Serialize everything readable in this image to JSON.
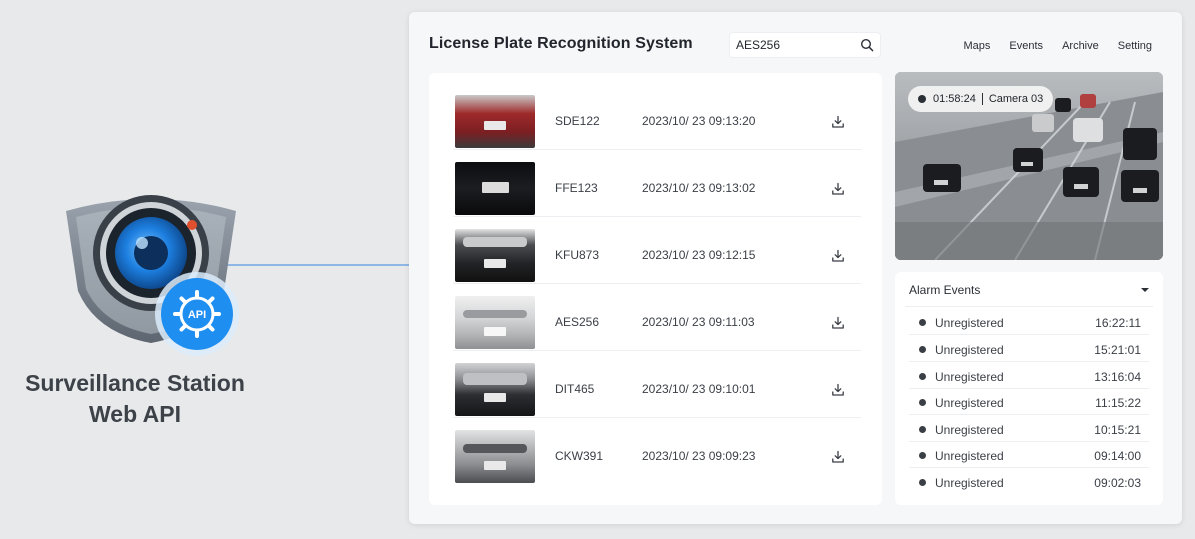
{
  "hero": {
    "title_line1": "Surveillance Station",
    "title_line2": "Web API",
    "badge_text": "API"
  },
  "header": {
    "title": "License Plate Recognition System",
    "search": {
      "value": "AES256",
      "placeholder": ""
    },
    "nav": [
      {
        "label": "Maps"
      },
      {
        "label": "Events"
      },
      {
        "label": "Archive"
      },
      {
        "label": "Setting"
      }
    ]
  },
  "records": [
    {
      "plate": "SDE122",
      "timestamp": "2023/10/ 23 09:13:20",
      "car_color": "#9e2a2b"
    },
    {
      "plate": "FFE123",
      "timestamp": "2023/10/ 23 09:13:02",
      "car_color": "#141518"
    },
    {
      "plate": "KFU873",
      "timestamp": "2023/10/ 23 09:12:15",
      "car_color": "#2f3134"
    },
    {
      "plate": "AES256",
      "timestamp": "2023/10/ 23 09:11:03",
      "car_color": "#d8d9da"
    },
    {
      "plate": "DIT465",
      "timestamp": "2023/10/ 23 09:10:01",
      "car_color": "#3a3c40"
    },
    {
      "plate": "CKW391",
      "timestamp": "2023/10/ 23 09:09:23",
      "car_color": "#b9bbbd"
    }
  ],
  "camera": {
    "time": "01:58:24",
    "name": "Camera 03"
  },
  "alarm": {
    "title": "Alarm Events",
    "events": [
      {
        "label": "Unregistered",
        "time": "16:22:11"
      },
      {
        "label": "Unregistered",
        "time": "15:21:01"
      },
      {
        "label": "Unregistered",
        "time": "13:16:04"
      },
      {
        "label": "Unregistered",
        "time": "11:15:22"
      },
      {
        "label": "Unregistered",
        "time": "10:15:21"
      },
      {
        "label": "Unregistered",
        "time": "09:14:00"
      },
      {
        "label": "Unregistered",
        "time": "09:02:03"
      }
    ]
  },
  "colors": {
    "accent_blue": "#1f8ef1",
    "link_line": "#8fb7e6",
    "panel_bg": "#f6f7f9"
  }
}
